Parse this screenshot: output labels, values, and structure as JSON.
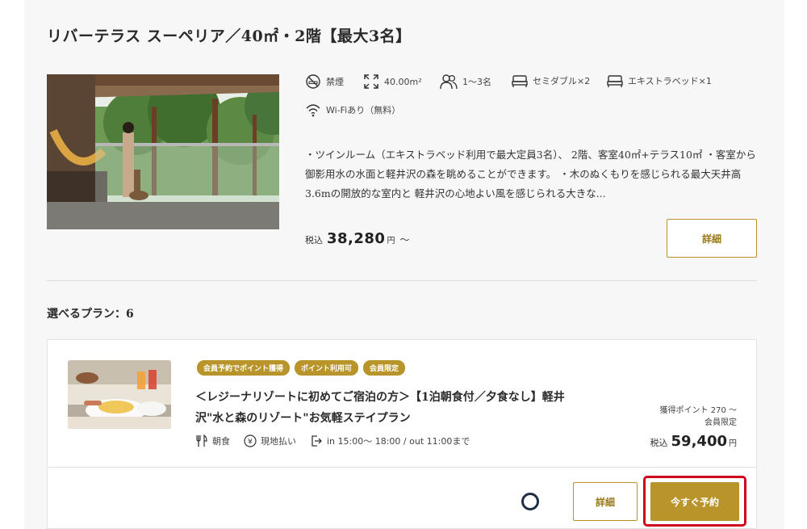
{
  "room": {
    "title": "リバーテラス スーペリア／40㎡・2階【最大3名】",
    "amenities": {
      "smoking": "禁煙",
      "area": "40.00m²",
      "capacity": "1〜3名",
      "bed1": "セミダブル×2",
      "bed2": "エキストラベッド×1",
      "wifi": "Wi-Fiあり（無料）"
    },
    "description": "・ツインルーム（エキストラベッド利用で最大定員3名）、 2階、客室40㎡+テラス10㎡ ・客室から御影用水の水面と軽井沢の森を眺めることができます。 ・木のぬくもりを感じられる最大天井高3.6mの開放的な室内と 軽井沢の心地よい風を感じられる大きな...",
    "price_prefix": "税込",
    "price": "38,280",
    "price_unit": "円",
    "price_suffix": "〜",
    "detail_button": "詳細"
  },
  "plans": {
    "label": "選べるプラン：",
    "count": "6"
  },
  "plan": {
    "badges": [
      "会員予約でポイント獲得",
      "ポイント利用可",
      "会員限定"
    ],
    "title": "＜レジーナリゾートに初めてご宿泊の方＞【1泊朝食付／夕食なし】軽井沢\"水と森のリゾート\"お気軽ステイプラン",
    "meal": "朝食",
    "payment": "現地払い",
    "checkin": "in 15:00〜 18:00 / out 11:00まで",
    "points": "獲得ポイント 270 〜",
    "member": "会員限定",
    "price_prefix": "税込",
    "price": "59,400",
    "price_unit": "円",
    "detail_button": "詳細",
    "book_button": "今すぐ予約"
  },
  "colors": {
    "accent_gold": "#b8942a",
    "highlight_red": "#d0021b",
    "spinner_navy": "#1f2e44"
  }
}
